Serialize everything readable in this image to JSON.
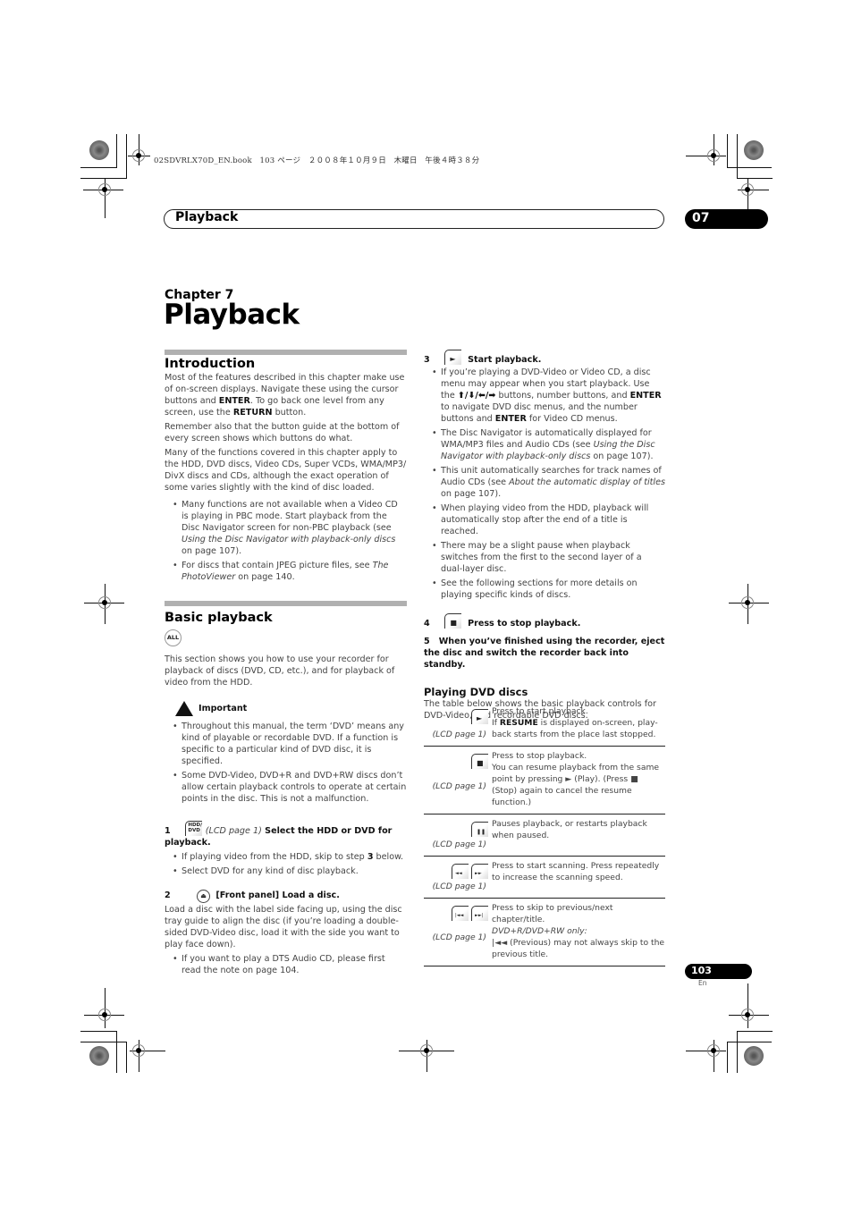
{
  "bookline": "02SDVRLX70D_EN.book　103 ページ　２００８年１０月９日　木曜日　午後４時３８分",
  "header": {
    "title": "Playback",
    "chapter_number": "07"
  },
  "chapter": {
    "label": "Chapter 7",
    "title": "Playback"
  },
  "introduction": {
    "title": "Introduction",
    "p1_a": "Most of the features described in this chapter make use of on-screen displays. Navigate these using the cursor buttons and ",
    "p1_enter": "ENTER",
    "p1_b": ". To go back one level from any screen, use the ",
    "p1_return": "RETURN",
    "p1_c": " button.",
    "p2": "Remember also that the button guide at the bottom of every screen shows which buttons do what.",
    "p3": "Many of the functions covered in this chapter apply to the HDD, DVD discs, Video CDs, Super VCDs, WMA/MP3/ DivX discs and CDs, although the exact operation of some varies slightly with the kind of disc loaded.",
    "bullet1_a": "Many functions are not available when a Video CD is playing in PBC mode. Start playback from the Disc Navigator screen for non-PBC playback (see ",
    "bullet1_ref": "Using the Disc Navigator with playback-only discs",
    "bullet1_b": " on page 107).",
    "bullet2_a": "For discs that contain JPEG picture files, see ",
    "bullet2_ref": "The PhotoViewer",
    "bullet2_b": " on page 140."
  },
  "basic": {
    "title": "Basic playback",
    "badge": "ALL",
    "intro": "This section shows you how to use your recorder for playback of discs (DVD, CD, etc.), and for playback of video from the HDD.",
    "important_label": "Important",
    "imp1": "Throughout this manual, the term ‘DVD’ means any kind of playable or recordable DVD. If a function is specific to a particular kind of DVD disc, it is specified.",
    "imp2": "Some DVD-Video, DVD+R and DVD+RW discs don’t allow certain playback controls to operate at certain points in the disc. This is not a malfunction.",
    "step1_num": "1",
    "step1_icon": "HDD/ DVD",
    "step1_lcd": "(LCD page 1)",
    "step1_text": "Select the HDD or DVD for playback.",
    "step1_b1_a": "If playing video from the HDD, skip to step ",
    "step1_b1_step": "3",
    "step1_b1_b": " below.",
    "step1_b2": "Select DVD for any kind of disc playback.",
    "step2_num": "2",
    "step2_text": "[Front panel] Load a disc.",
    "step2_body": "Load a disc with the label side facing up, using the disc tray guide to align the disc (if you’re loading a double-sided DVD-Video disc, load it with the side you want to play face down).",
    "step2_b1": "If you want to play a DTS Audio CD, please first read the note on page 104."
  },
  "right": {
    "step3_num": "3",
    "step3_text": "Start playback.",
    "s3b1_a": "If you’re playing a DVD-Video or Video CD, a disc menu may appear when you start playback. Use the ",
    "s3b1_arrows": "⬆/⬇/⬅/➡",
    "s3b1_b": " buttons, number buttons, and ",
    "s3b1_enter": "ENTER",
    "s3b1_c": " to navigate DVD disc menus, and the number buttons and ",
    "s3b1_enter2": "ENTER",
    "s3b1_d": " for Video CD menus.",
    "s3b2_a": "The Disc Navigator is automatically displayed for WMA/MP3 files and Audio CDs (see ",
    "s3b2_ref": "Using the Disc Navigator with playback-only discs",
    "s3b2_b": " on page 107).",
    "s3b3_a": "This unit automatically searches for track names of Audio CDs (see ",
    "s3b3_ref": "About the automatic display of titles",
    "s3b3_b": " on page 107).",
    "s3b4": "When playing video from the HDD, playback will automatically stop after the end of a title is reached.",
    "s3b5": "There may be a slight pause when playback switches from the first to the second layer of a dual-layer disc.",
    "s3b6": "See the following sections for more details on playing specific kinds of discs.",
    "step4_num": "4",
    "step4_text": "Press to stop playback.",
    "step5_num": "5",
    "step5_text": "When you’ve finished using the recorder, eject the disc and switch the recorder back into standby.",
    "dvd_title": "Playing DVD discs",
    "dvd_intro": "The table below shows the basic playback controls for DVD-Video, and recordable DVD discs."
  },
  "table": {
    "lcd": "(LCD page 1)",
    "rows": [
      {
        "icons": [
          "►"
        ],
        "line1": "Press to start playback.",
        "line2_a": "If ",
        "line2_bold": "RESUME",
        "line2_b": " is displayed on-screen, play-back starts from the place last stopped."
      },
      {
        "icons": [
          "■"
        ],
        "line1": "Press to stop playback.",
        "line2": "You can resume playback from the same point by pressing ► (Play). (Press ■ (Stop) again to cancel the resume function.)"
      },
      {
        "icons": [
          "❚❚"
        ],
        "line1": "Pauses playback, or restarts playback when paused."
      },
      {
        "icons": [
          "◄◄",
          "►►"
        ],
        "line1": "Press to start scanning. Press repeatedly to increase the scanning speed."
      },
      {
        "icons": [
          "|◄◄",
          "►►|"
        ],
        "line1": "Press to skip to previous/next chapter/title.",
        "line2_italic": "DVD+R/DVD+RW only:",
        "line3": "|◄◄ (Previous) may not always skip to the previous title."
      }
    ]
  },
  "footer": {
    "page_number": "103",
    "language": "En"
  }
}
